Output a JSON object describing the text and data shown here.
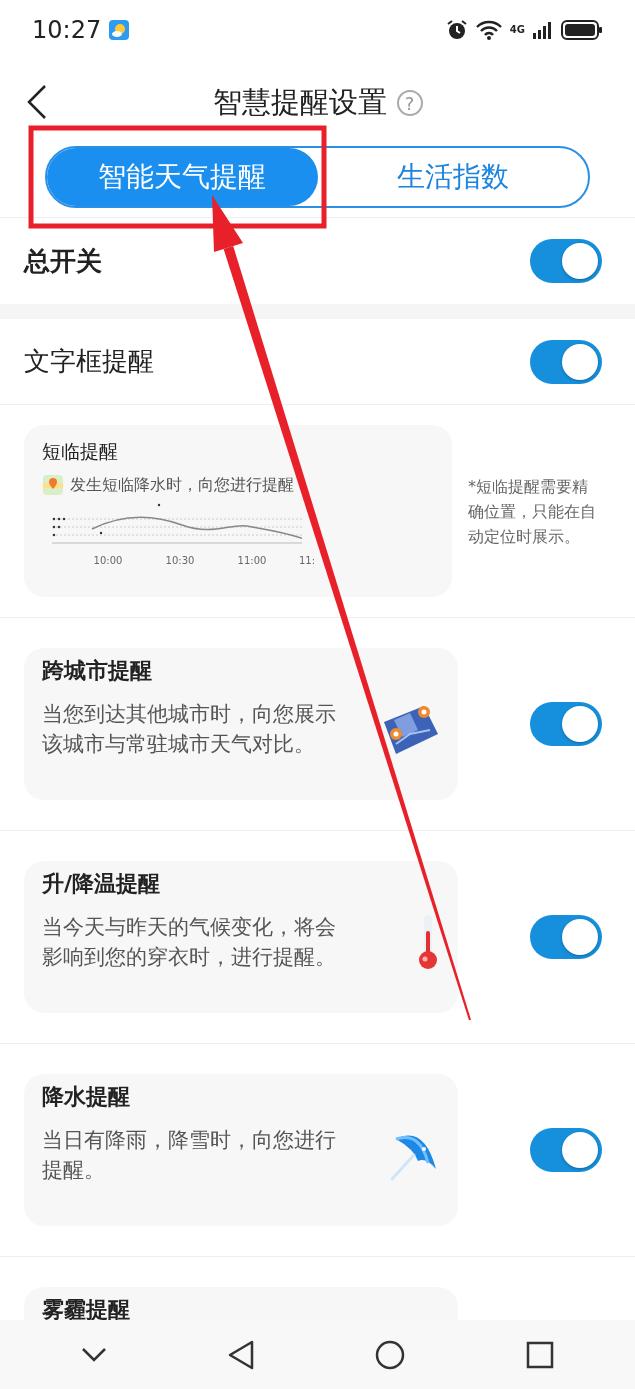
{
  "status_bar": {
    "time": "10:27",
    "network": "4G"
  },
  "header": {
    "title": "智慧提醒设置",
    "help": "?"
  },
  "tabs": [
    {
      "label": "智能天气提醒",
      "selected": true
    },
    {
      "label": "生活指数",
      "selected": false
    }
  ],
  "master_switch": {
    "label": "总开关",
    "on": true
  },
  "settings": [
    {
      "kind": "toggle",
      "label": "文字框提醒",
      "on": true
    },
    {
      "kind": "preview",
      "title": "短临提醒",
      "caption": "发生短临降水时，向您进行提醒",
      "time_labels": [
        "10:00",
        "10:30",
        "11:00",
        "11:"
      ],
      "note": "*短临提醒需要精确位置，只能在自动定位时展示。"
    },
    {
      "kind": "card",
      "title": "跨城市提醒",
      "description": "当您到达其他城市时，向您展示该城市与常驻城市天气对比。",
      "on": true
    },
    {
      "kind": "card",
      "title": "升/降温提醒",
      "description": "当今天与昨天的气候变化，将会影响到您的穿衣时，进行提醒。",
      "on": true
    },
    {
      "kind": "card",
      "title": "降水提醒",
      "description": "当日有降雨，降雪时，向您进行提醒。",
      "on": true
    },
    {
      "kind": "card",
      "title": "雾霾提醒"
    }
  ]
}
